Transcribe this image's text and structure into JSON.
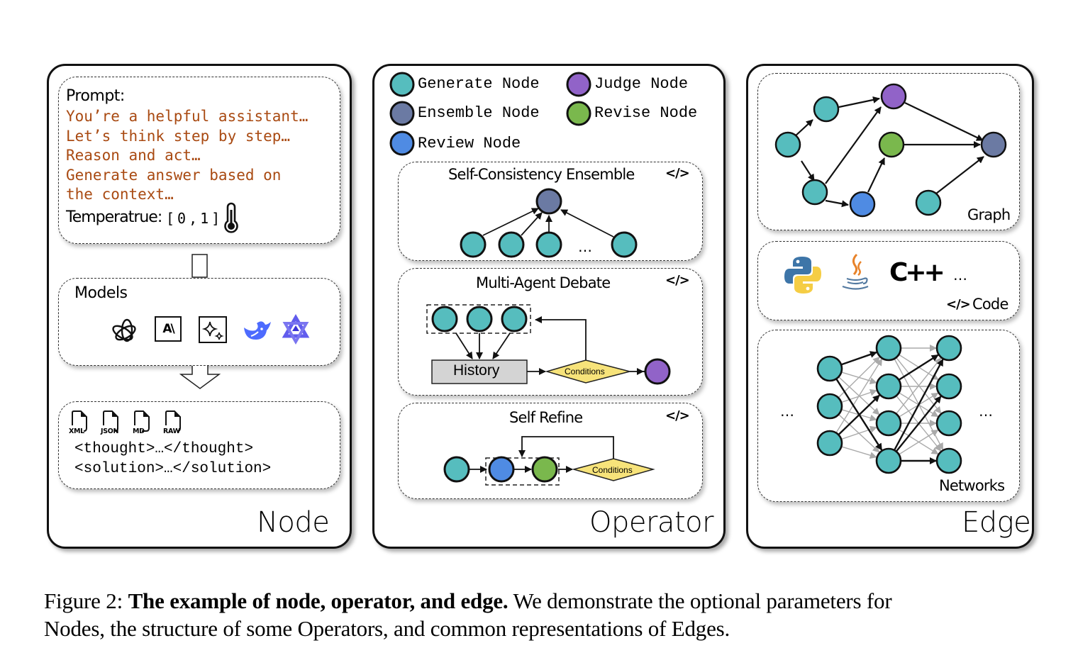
{
  "panels": {
    "node": {
      "title": "Node",
      "prompt": {
        "label": "Prompt:",
        "lines": [
          "You’re a helpful assistant…",
          "Let’s think step by step…",
          "Reason and act…",
          "Generate answer based on",
          "the context…"
        ],
        "temperature_label": "Temperatrue:",
        "temperature_range": "[0,1]",
        "temperature_icon": "thermometer-icon"
      },
      "models": {
        "label": "Models",
        "icons": [
          "openai-icon",
          "anthropic-icon",
          "gemini-icon",
          "deepseek-icon",
          "qwen-icon"
        ],
        "anthropic_text": "A\\"
      },
      "formats": {
        "files": [
          "XML",
          "JSON",
          "MD",
          "RAW"
        ],
        "lines": [
          "<thought>…</thought>",
          "<solution>…</solution>"
        ]
      }
    },
    "operator": {
      "title": "Operator",
      "legend": [
        {
          "label": "Generate Node",
          "color": "#56bdbe"
        },
        {
          "label": "Judge Node",
          "color": "#9163c8"
        },
        {
          "label": "Ensemble Node",
          "color": "#6b7aa3"
        },
        {
          "label": "Revise Node",
          "color": "#7ab84d"
        },
        {
          "label": "Review Node",
          "color": "#4f8be3"
        }
      ],
      "operators": [
        {
          "title": "Self-Consistency Ensemble",
          "code_icon": "</>",
          "ellipsis": "…"
        },
        {
          "title": "Multi-Agent Debate",
          "code_icon": "</>",
          "history_label": "History",
          "condition_label": "Conditions"
        },
        {
          "title": "Self Refine",
          "code_icon": "</>",
          "condition_label": "Conditions"
        }
      ]
    },
    "edge": {
      "title": "Edge",
      "graph_label": "Graph",
      "code_label": "Code",
      "code_icon": "</>",
      "code_languages": [
        "python-icon",
        "java-icon",
        "cpp-icon"
      ],
      "code_ellipsis": "…",
      "cpp_text": "C++",
      "networks_label": "Networks",
      "networks_ellipsis_left": "…",
      "networks_ellipsis_right": "…"
    }
  },
  "colors": {
    "generate": "#56bdbe",
    "judge": "#9163c8",
    "ensemble": "#6b7aa3",
    "revise": "#7ab84d",
    "review": "#4f8be3",
    "condition": "#f7e37a",
    "history": "#d4d4d4",
    "prompt_text": "#a94a12"
  },
  "caption": {
    "prefix": "Figure 2:",
    "bold": "The example of node, operator, and edge.",
    "line1_rest": "We demonstrate the optional parameters for",
    "line2": "Nodes, the structure of some Operators, and common representations of Edges."
  }
}
